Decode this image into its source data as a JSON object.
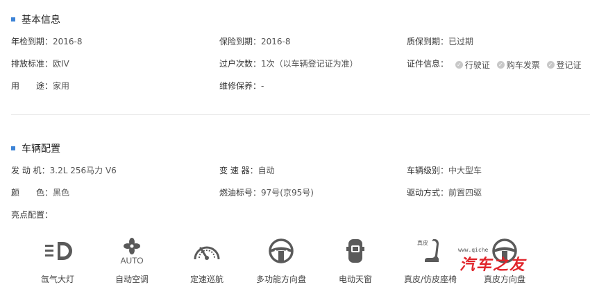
{
  "colors": {
    "accent": "#3c83d6",
    "watermark": "#e0252b"
  },
  "basic": {
    "title": "基本信息",
    "inspect_label": "年检到期：",
    "inspect_value": "2016-8",
    "insurance_label": "保险到期：",
    "insurance_value": "2016-8",
    "warranty_label": "质保到期：",
    "warranty_value": "已过期",
    "emission_label": "排放标准：",
    "emission_value": "欧IV",
    "transfer_label": "过户次数：",
    "transfer_value": "1次（以车辆登记证为准）",
    "docs_label": "证件信息：",
    "docs": [
      "行驶证",
      "购车发票",
      "登记证"
    ],
    "usage_label": "用　　途：",
    "usage_value": "家用",
    "maintenance_label": "维修保养：",
    "maintenance_value": "-"
  },
  "config": {
    "title": "车辆配置",
    "engine_label": "发 动 机：",
    "engine_value": "3.2L 256马力 V6",
    "gearbox_label": "变 速 器：",
    "gearbox_value": "自动",
    "class_label": "车辆级别：",
    "class_value": "中大型车",
    "color_label": "颜　　色：",
    "color_value": "黑色",
    "fuel_label": "燃油标号：",
    "fuel_value": "97号(京95号)",
    "drive_label": "驱动方式：",
    "drive_value": "前置四驱",
    "highlights_label": "亮点配置："
  },
  "features": [
    {
      "label": "氙气大灯",
      "icon": "xenon-headlight-icon"
    },
    {
      "label": "自动空调",
      "icon": "auto-ac-icon",
      "icon_text": "AUTO"
    },
    {
      "label": "定速巡航",
      "icon": "cruise-control-icon"
    },
    {
      "label": "多功能方向盘",
      "icon": "multifunction-wheel-icon"
    },
    {
      "label": "电动天窗",
      "icon": "sunroof-icon"
    },
    {
      "label": "真皮/仿皮座椅",
      "icon": "leather-seat-icon",
      "icon_text": "真皮"
    },
    {
      "label": "真皮方向盘",
      "icon": "leather-wheel-icon"
    }
  ],
  "watermark": {
    "url": "www.qiche",
    "text": "汽车之友"
  }
}
